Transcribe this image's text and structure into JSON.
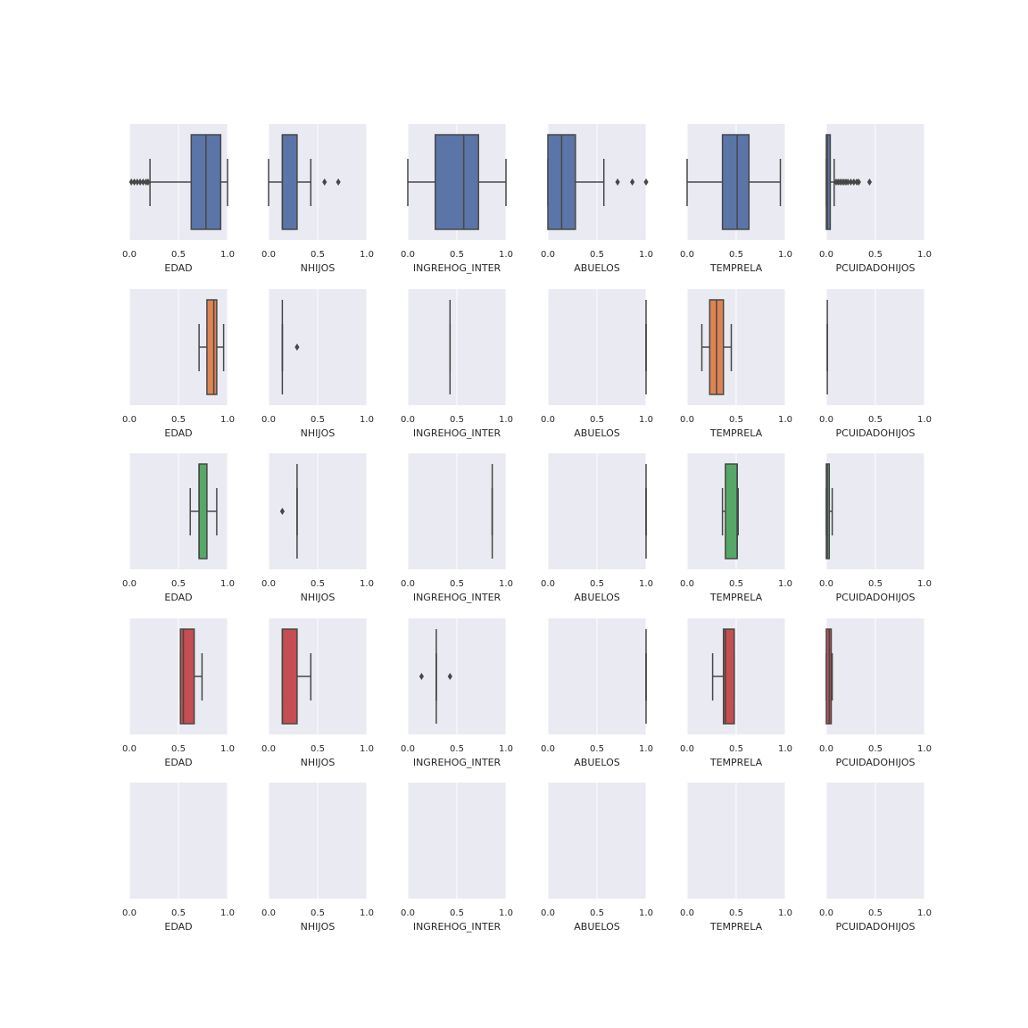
{
  "chart_data": {
    "type": "box",
    "layout": {
      "rows": 5,
      "cols": 6
    },
    "row_colors": [
      "#5b75a8",
      "#dd8452",
      "#55a868",
      "#c44e52",
      null
    ],
    "colors": {
      "background": "#eaeaf2",
      "grid": "#ffffff",
      "line": "#474747"
    },
    "grid": true,
    "xlim": [
      0,
      1
    ],
    "xticks": [
      "0.0",
      "0.5",
      "1.0"
    ],
    "variables": [
      "EDAD",
      "NHIJOS",
      "INGREHOG_INTER",
      "ABUELOS",
      "TEMPRELA",
      "PCUIDADOHIJOS"
    ],
    "rows": [
      [
        {
          "q1": 0.63,
          "median": 0.78,
          "q3": 0.93,
          "whislo": 0.21,
          "whishi": 1.0,
          "fliers": [
            0.02,
            0.05,
            0.08,
            0.11,
            0.14,
            0.17,
            0.19
          ]
        },
        {
          "q1": 0.14,
          "median": 0.14,
          "q3": 0.29,
          "whislo": 0.0,
          "whishi": 0.43,
          "fliers": [
            0.57,
            0.71
          ]
        },
        {
          "q1": 0.28,
          "median": 0.57,
          "q3": 0.72,
          "whislo": 0.0,
          "whishi": 1.0,
          "fliers": []
        },
        {
          "q1": 0.0,
          "median": 0.14,
          "q3": 0.28,
          "whislo": 0.0,
          "whishi": 0.57,
          "fliers": [
            0.71,
            0.86,
            1.0
          ]
        },
        {
          "q1": 0.36,
          "median": 0.51,
          "q3": 0.63,
          "whislo": 0.0,
          "whishi": 0.95,
          "fliers": []
        },
        {
          "q1": 0.0,
          "median": 0.01,
          "q3": 0.04,
          "whislo": 0.0,
          "whishi": 0.08,
          "fliers": [
            0.1,
            0.12,
            0.14,
            0.16,
            0.18,
            0.2,
            0.22,
            0.25,
            0.28,
            0.31,
            0.33,
            0.44
          ]
        }
      ],
      [
        {
          "q1": 0.79,
          "median": 0.86,
          "q3": 0.89,
          "whislo": 0.71,
          "whishi": 0.96,
          "fliers": []
        },
        {
          "q1": 0.14,
          "median": 0.14,
          "q3": 0.14,
          "whislo": 0.14,
          "whishi": 0.14,
          "fliers": [
            0.29
          ]
        },
        {
          "q1": 0.43,
          "median": 0.43,
          "q3": 0.43,
          "whislo": 0.43,
          "whishi": 0.43,
          "fliers": []
        },
        {
          "q1": 1.0,
          "median": 1.0,
          "q3": 1.0,
          "whislo": 1.0,
          "whishi": 1.0,
          "fliers": []
        },
        {
          "q1": 0.23,
          "median": 0.3,
          "q3": 0.37,
          "whislo": 0.15,
          "whishi": 0.45,
          "fliers": []
        },
        {
          "q1": 0.01,
          "median": 0.01,
          "q3": 0.01,
          "whislo": 0.01,
          "whishi": 0.01,
          "fliers": []
        }
      ],
      [
        {
          "q1": 0.71,
          "median": 0.71,
          "q3": 0.79,
          "whislo": 0.62,
          "whishi": 0.89,
          "fliers": []
        },
        {
          "q1": 0.29,
          "median": 0.29,
          "q3": 0.29,
          "whislo": 0.29,
          "whishi": 0.29,
          "fliers": [
            0.14
          ]
        },
        {
          "q1": 0.86,
          "median": 0.86,
          "q3": 0.86,
          "whislo": 0.86,
          "whishi": 0.86,
          "fliers": []
        },
        {
          "q1": 1.0,
          "median": 1.0,
          "q3": 1.0,
          "whislo": 1.0,
          "whishi": 1.0,
          "fliers": []
        },
        {
          "q1": 0.39,
          "median": 0.51,
          "q3": 0.51,
          "whislo": 0.36,
          "whishi": 0.52,
          "fliers": []
        },
        {
          "q1": 0.0,
          "median": 0.01,
          "q3": 0.03,
          "whislo": 0.0,
          "whishi": 0.06,
          "fliers": []
        }
      ],
      [
        {
          "q1": 0.52,
          "median": 0.55,
          "q3": 0.66,
          "whislo": 0.52,
          "whishi": 0.74,
          "fliers": []
        },
        {
          "q1": 0.14,
          "median": 0.14,
          "q3": 0.29,
          "whislo": 0.14,
          "whishi": 0.43,
          "fliers": []
        },
        {
          "q1": 0.29,
          "median": 0.29,
          "q3": 0.29,
          "whislo": 0.29,
          "whishi": 0.29,
          "fliers": [
            0.14,
            0.43
          ]
        },
        {
          "q1": 1.0,
          "median": 1.0,
          "q3": 1.0,
          "whislo": 1.0,
          "whishi": 1.0,
          "fliers": []
        },
        {
          "q1": 0.37,
          "median": 0.39,
          "q3": 0.48,
          "whislo": 0.26,
          "whishi": 0.48,
          "fliers": []
        },
        {
          "q1": 0.0,
          "median": 0.03,
          "q3": 0.05,
          "whislo": 0.0,
          "whishi": 0.06,
          "fliers": []
        }
      ],
      [
        null,
        null,
        null,
        null,
        null,
        null
      ]
    ]
  }
}
